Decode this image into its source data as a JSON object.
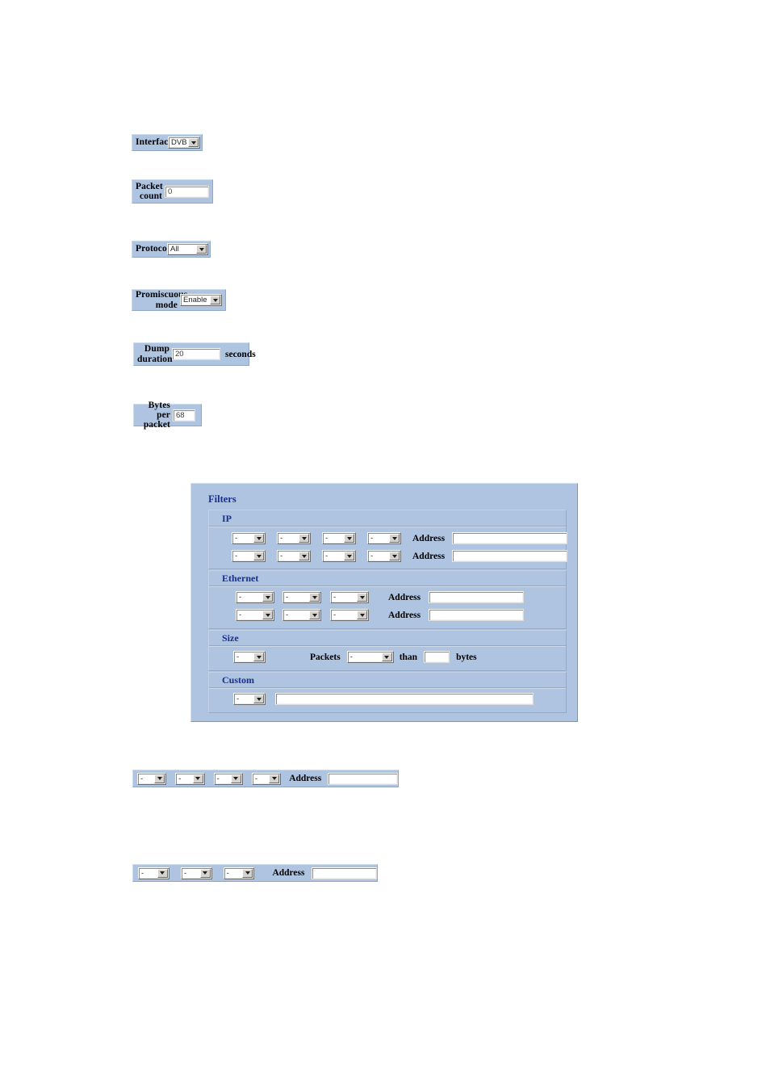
{
  "form": {
    "rows": [
      {
        "name": "interface",
        "label": "Interface",
        "control": "select",
        "value": "DVB"
      },
      {
        "name": "packet-count",
        "label": "Packet count",
        "control": "text",
        "value": "0"
      },
      {
        "name": "protocol",
        "label": "Protocol",
        "control": "select",
        "value": "All"
      },
      {
        "name": "promiscuous-mode",
        "label": "Promiscuous mode",
        "control": "select",
        "value": "Enable"
      },
      {
        "name": "dump-duration",
        "label": "Dump duration",
        "control": "text",
        "value": "20",
        "unit": "seconds"
      },
      {
        "name": "bytes-per-packet",
        "label": "Bytes per packet",
        "control": "text",
        "value": "68"
      }
    ]
  },
  "filters": {
    "title": "Filters",
    "sections": {
      "ip": {
        "title": "IP",
        "rows": [
          {
            "selects": [
              "-",
              "-",
              "-",
              "-"
            ],
            "address_label": "Address",
            "address_value": ""
          },
          {
            "selects": [
              "-",
              "-",
              "-",
              "-"
            ],
            "address_label": "Address",
            "address_value": ""
          }
        ]
      },
      "ethernet": {
        "title": "Ethernet",
        "rows": [
          {
            "selects": [
              "-",
              "-",
              "-"
            ],
            "address_label": "Address",
            "address_value": ""
          },
          {
            "selects": [
              "-",
              "-",
              "-"
            ],
            "address_label": "Address",
            "address_value": ""
          }
        ]
      },
      "size": {
        "title": "Size",
        "row": {
          "mode_select": "-",
          "packets_label": "Packets",
          "compare_select": "-",
          "than_label": "than",
          "size_value": "",
          "bytes_label": "bytes"
        }
      },
      "custom": {
        "title": "Custom",
        "row": {
          "select": "-",
          "expression": ""
        }
      }
    }
  },
  "standalone": {
    "ip_row": {
      "selects": [
        "-",
        "-",
        "-",
        "-"
      ],
      "address_label": "Address",
      "address_value": ""
    },
    "ethernet_row": {
      "selects": [
        "-",
        "-",
        "-"
      ],
      "address_label": "Address",
      "address_value": ""
    }
  }
}
